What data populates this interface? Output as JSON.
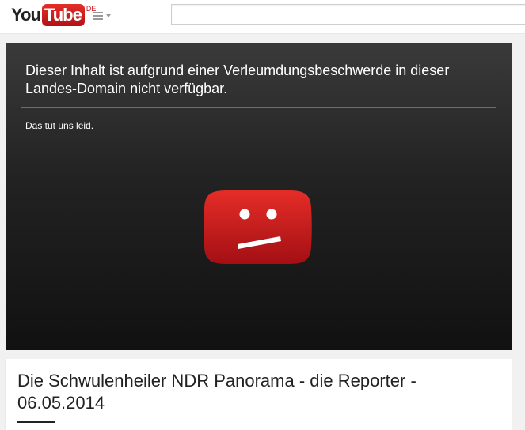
{
  "header": {
    "logo_you": "You",
    "logo_tube": "Tube",
    "logo_country": "DE",
    "search": {
      "value": "",
      "placeholder": ""
    }
  },
  "player": {
    "message": "Dieser Inhalt ist aufgrund einer Verleumdungsbeschwerde in dieser Landes-Domain nicht verfügbar.",
    "subtext": "Das tut uns leid.",
    "error_icon": "sad-youtube-logo-icon"
  },
  "video": {
    "title": "Die Schwulenheiler NDR Panorama - die Reporter - 06.05.2014"
  },
  "colors": {
    "brand_red": "#cc181e",
    "player_bg": "#222222",
    "page_bg": "#f1f1f1"
  }
}
